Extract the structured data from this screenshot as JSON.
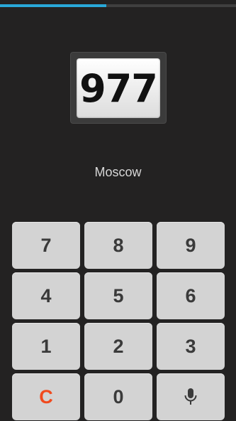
{
  "progress": {
    "fraction": 0.45,
    "color": "#29a8d8"
  },
  "display": {
    "value": "977"
  },
  "location": {
    "city": "Moscow"
  },
  "keypad": {
    "keys": [
      "7",
      "8",
      "9",
      "4",
      "5",
      "6",
      "1",
      "2",
      "3",
      "C",
      "0"
    ],
    "mic_icon": "microphone-icon",
    "clear_color": "#f04a1e"
  }
}
